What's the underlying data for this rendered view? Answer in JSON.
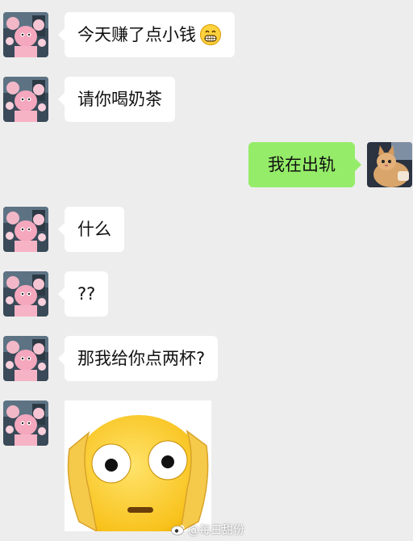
{
  "chat": {
    "messages": [
      {
        "text": "今天赚了点小钱",
        "emoji": "grinning-face-icon"
      },
      {
        "text": "请你喝奶茶"
      },
      {
        "text": "我在出轨"
      },
      {
        "text": "什么"
      },
      {
        "text": "??"
      },
      {
        "text": "那我给你点两杯?"
      },
      {
        "sticker": "shocked-face-sticker"
      }
    ]
  },
  "watermark": {
    "text": "@每日甜份"
  },
  "colors": {
    "background": "#ededed",
    "incoming_bubble": "#ffffff",
    "outgoing_bubble": "#95ec69"
  }
}
